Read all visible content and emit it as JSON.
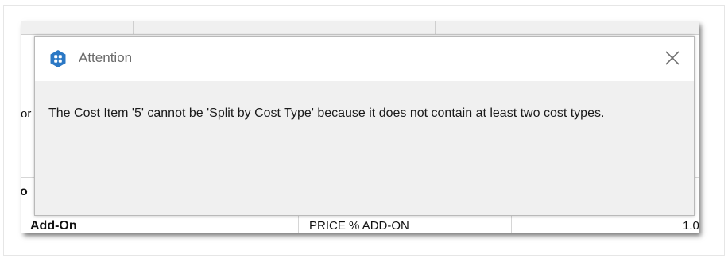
{
  "dialog": {
    "title": "Attention",
    "message": "The Cost Item '5' cannot be 'Split by Cost Type' because it does not contain at least two cost types.",
    "app_icon": "app-logo-icon",
    "close_icon": "close-icon",
    "accent_color": "#2b78c5"
  },
  "background_grid": {
    "left_fragments": [
      "or",
      "o"
    ],
    "row_label": "Add-On",
    "row_type": "PRICE % ADD-ON",
    "right_values": [
      ".0",
      ".0",
      "1.0"
    ]
  }
}
